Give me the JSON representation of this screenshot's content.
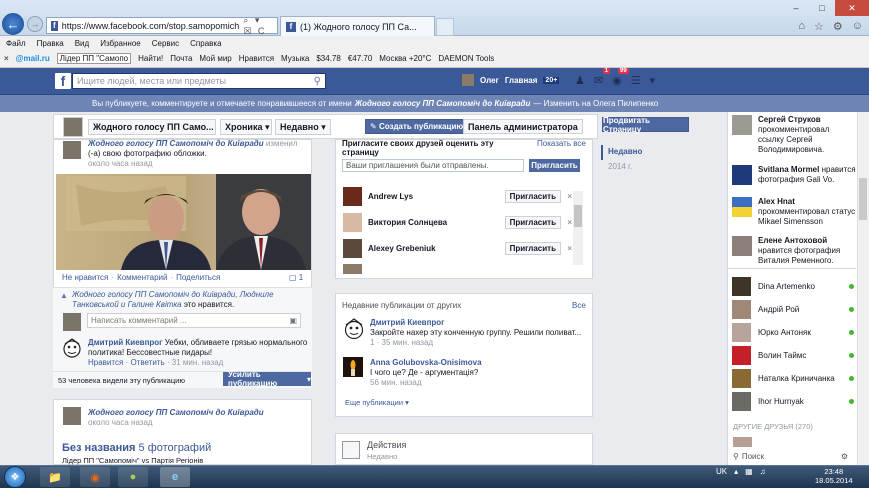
{
  "browser": {
    "url": "https://www.facebook.com/stop.samopomich",
    "address_actions": "⌕ ▾ ☒ C",
    "tab_title": "(1) Жодного голосу ПП Са...",
    "favicon": "f",
    "menu": [
      "Файл",
      "Правка",
      "Вид",
      "Избранное",
      "Сервис",
      "Справка"
    ],
    "toolbar": {
      "close": "×",
      "mail": "@mail.ru",
      "leader": "Лідер ПП \"Самопо",
      "find": "Найти!",
      "mail_link": "Почта",
      "moimir": "Мой мир",
      "likes": "Нравится",
      "music": "Музыка",
      "usd": "$34.78",
      "eur": "€47.70",
      "weather": "Москва +20°C",
      "daemon": "DAEMON Tools"
    },
    "window_controls": [
      "–",
      "□",
      "✕"
    ],
    "icons": [
      "home-icon",
      "star-icon",
      "gear-icon",
      "smiley-icon"
    ]
  },
  "fb": {
    "logo": "f",
    "search_placeholder": "Ищите людей, места или предметы",
    "user_name": "Олег",
    "home": "Главная",
    "home_count": "20+",
    "msg_badge": "1",
    "notif_badge": "99",
    "notice_prefix": "Вы публикуете, комментируете и отмечаете понравившееся от имени",
    "notice_page": "Жодного голосу ПП Самопоміч до Київради",
    "notice_suffix": "— Изменить на Олега Пилипенко"
  },
  "page": {
    "name_btn": "Жодного голосу ПП Само...",
    "timeline": "Хроника",
    "recent": "Недавно",
    "create_post": "Создать публикацию",
    "admin_panel": "Панель администратора",
    "promote": "Продвигать Страницу"
  },
  "post1": {
    "author": "Жодного голосу ПП Самопоміч до Київради",
    "action": "изменил",
    "action2": "(-а) свою фотографию обложки.",
    "time": "около часа назад",
    "unlike": "Не нравится",
    "comment": "Комментарий",
    "share": "Поделиться",
    "sep": "·",
    "comment_count": "1",
    "likes_text": "Жодного голосу ПП Самопоміч до Київради, Людниле Танковськой и Галине Квітка",
    "likes_suffix": "это нравится.",
    "comment_placeholder": "Написать комментарий ...",
    "c_author": "Дмитрий Киевпрог",
    "c_text": "Уебки, обливаете грязью нормального политика! Бессовестные пидары!",
    "c_like": "Нравится",
    "c_reply": "Ответить",
    "c_time": "31 мин. назад",
    "views": "53 человека видели эту публикацию",
    "boost": "Усилить публикацию"
  },
  "post2": {
    "author": "Жодного голосу ПП Самопоміч до Київради",
    "time": "около часа назад",
    "album": "Без названия",
    "album_count": "5 фотографий",
    "album_sub": "Лідер ПП \"Самопоміч\" vs Партія Регіонів"
  },
  "invite": {
    "title": "Пригласите своих друзей оценить эту страницу",
    "show_all": "Показать все",
    "input_value": "Ваши приглашения были отправлены.",
    "button": "Пригласить",
    "friends": [
      {
        "name": "Andrew Lys",
        "btn": "Пригласить",
        "color": "#6a2a1a"
      },
      {
        "name": "Виктория Солнцева",
        "btn": "Пригласить",
        "color": "#d9b9a4"
      },
      {
        "name": "Alexey Grebeniuk",
        "btn": "Пригласить",
        "color": "#5a4a3c"
      },
      {
        "name": "",
        "btn": "",
        "color": "#8b7a67"
      }
    ],
    "x": "×"
  },
  "recent_posts": {
    "title": "Недавние публикации от других",
    "all": "Все",
    "items": [
      {
        "author": "Дмитрий Киевпрог",
        "text": "Закройте нахер эту конченную группу. Решили поливат...",
        "meta": "1 · 35 мин. назад"
      },
      {
        "author": "Anna Golubovska-Onisimova",
        "text": "І чого це? Де - аргументація?",
        "meta": "56 мин. назад"
      }
    ],
    "more": "Еще публикации"
  },
  "activity": {
    "title": "Действия",
    "sub": "Недавно"
  },
  "timeline_nav": {
    "recent": "Недавно",
    "year": "2014 г."
  },
  "ticker": [
    {
      "name": "Сергей Струков",
      "text": "прокомментировал ссылку Сергей Володимировича."
    },
    {
      "name": "Svitlana Mormel",
      "text": "нравится фотография Gali Vo."
    },
    {
      "name": "Alex Hnat",
      "text": "прокомментировал статус Mikael Simensson"
    },
    {
      "name": "Елене Антоховой",
      "text": "нравится фотография Виталия Ременного."
    }
  ],
  "chat": [
    {
      "name": "Dina Artemenko",
      "online": true
    },
    {
      "name": "Андрій Рой",
      "online": true
    },
    {
      "name": "Юрко Антоняк",
      "online": true
    },
    {
      "name": "Волин Таймс",
      "online": true
    },
    {
      "name": "Наталка Криничанка",
      "online": true
    },
    {
      "name": "Ihor Hurnyak",
      "online": true
    }
  ],
  "other_friends": "ДРУГИЕ ДРУЗЬЯ (270)",
  "chat_search": "Поиск",
  "taskbar": {
    "lang": "UK",
    "time": "23:48",
    "date": "18.05.2014"
  }
}
